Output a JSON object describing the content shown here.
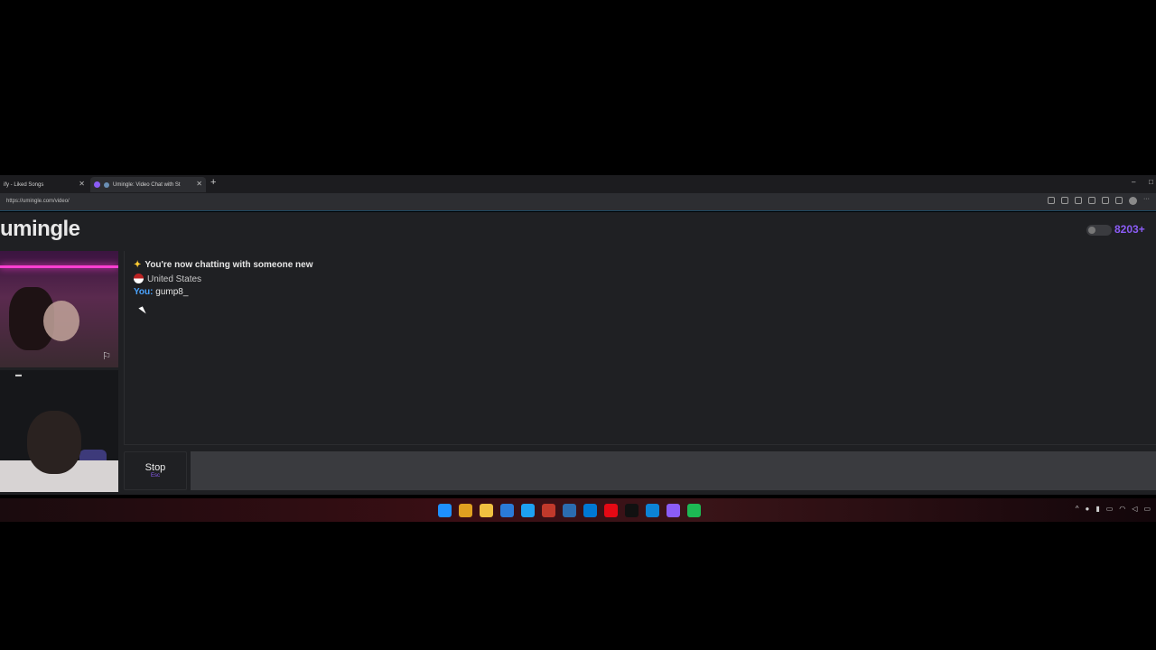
{
  "browser": {
    "tabs": [
      {
        "label": "ify - Liked Songs",
        "active": false
      },
      {
        "label": "Umingle: Video Chat with St",
        "active": true
      }
    ],
    "new_tab": "+",
    "url": "https://umingle.com/video/",
    "window_controls": [
      "–",
      "□"
    ]
  },
  "page": {
    "logo": "umingle",
    "online_count": "8203+",
    "accent_color": "#8b5cf6"
  },
  "chat": {
    "system_message": "You're now chatting with someone new",
    "country": "United States",
    "you_label": "You:",
    "you_text": "gump8_"
  },
  "controls": {
    "stop_label": "Stop",
    "stop_hint": "Esc",
    "input_placeholder": ""
  },
  "icons": {
    "report": "flag-icon",
    "sparkle": "sparkle-icon"
  }
}
